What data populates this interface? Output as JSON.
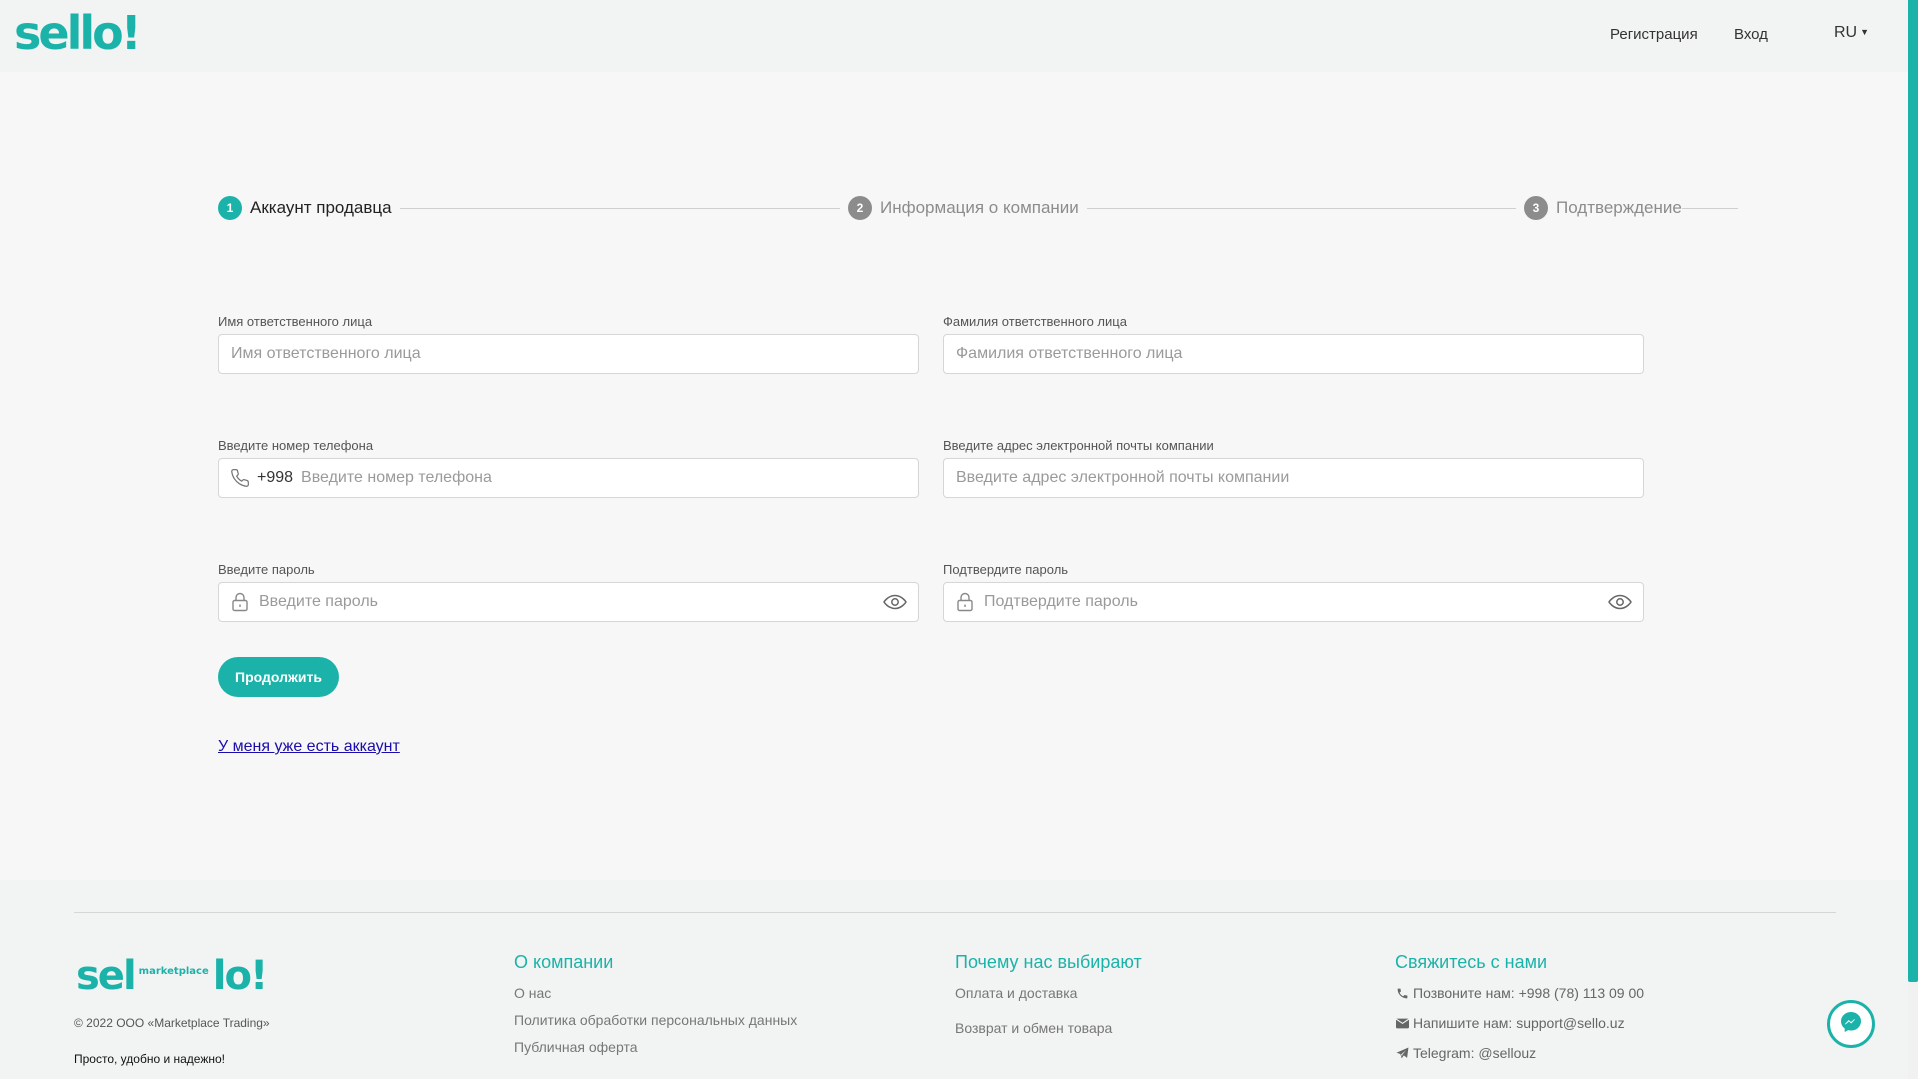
{
  "header": {
    "logo_text": "sello!",
    "register_link": "Регистрация",
    "login_link": "Вход",
    "language": "RU"
  },
  "stepper": {
    "steps": [
      {
        "num": "1",
        "label": "Аккаунт продавца"
      },
      {
        "num": "2",
        "label": "Информация о компании"
      },
      {
        "num": "3",
        "label": "Подтверждение"
      }
    ]
  },
  "form": {
    "first_name": {
      "label": "Имя ответственного лица",
      "placeholder": "Имя ответственного лица"
    },
    "last_name": {
      "label": "Фамилия ответственного лица",
      "placeholder": "Фамилия ответственного лица"
    },
    "phone": {
      "label": "Введите номер телефона",
      "prefix": "+998",
      "placeholder": "Введите номер телефона"
    },
    "email": {
      "label": "Введите адрес электронной почты компании",
      "placeholder": "Введите адрес электронной почты компании"
    },
    "password": {
      "label": "Введите пароль",
      "placeholder": "Введите пароль"
    },
    "confirm_password": {
      "label": "Подтвердите пароль",
      "placeholder": "Подтвердите пароль"
    },
    "continue_button": "Продолжить",
    "have_account_link": "У меня уже есть аккаунт"
  },
  "footer": {
    "logo_left": "sel",
    "logo_small": "marketplace",
    "logo_right": "lo!",
    "copyright": "© 2022 ООО «Marketplace Trading»",
    "slogan": "Просто, удобно и надежно!",
    "about": {
      "title": "О компании",
      "links": [
        "О нас",
        "Политика обработки персональных данных",
        "Публичная оферта"
      ]
    },
    "why_us": {
      "title": "Почему нас выбирают",
      "links": [
        "Оплата и доставка",
        "Возврат и обмен товара"
      ]
    },
    "contact": {
      "title": "Свяжитесь с нами",
      "phone": "Позвоните нам: +998 (78) 113 09 00",
      "email": "Напишите нам: support@sello.uz",
      "telegram": "Telegram: @sellouz"
    }
  },
  "colors": {
    "accent": "#1bb3a9",
    "inactive_step": "#8c8c8c",
    "link": "#1a0dab"
  }
}
